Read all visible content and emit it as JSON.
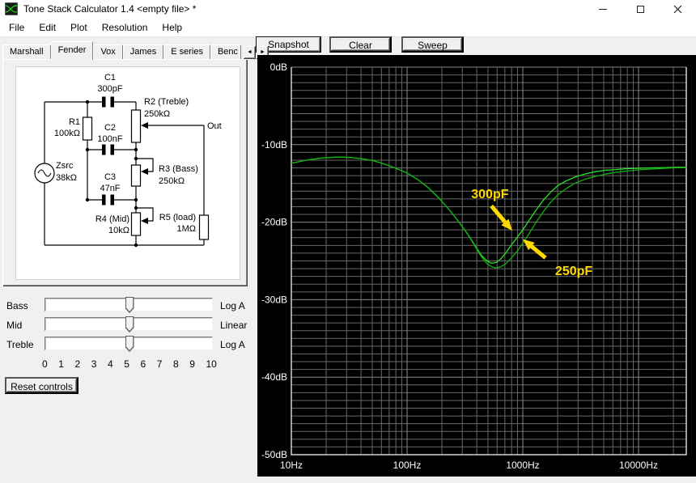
{
  "window": {
    "title": "Tone Stack Calculator 1.4 <empty file> *"
  },
  "menu": {
    "items": [
      "File",
      "Edit",
      "Plot",
      "Resolution",
      "Help"
    ]
  },
  "toolbar": {
    "snapshot": "Snapshot",
    "clear": "Clear",
    "sweep": "Sweep"
  },
  "tabs": {
    "items": [
      "Marshall",
      "Fender",
      "Vox",
      "James",
      "E series",
      "Benc"
    ],
    "active": "Fender"
  },
  "schematic": {
    "labels": {
      "c1_name": "C1",
      "c1_value": "300pF",
      "r2_name": "R2 (Treble)",
      "r2_value": "250kΩ",
      "r1_name": "R1",
      "r1_value": "100kΩ",
      "c2_name": "C2",
      "c2_value": "100nF",
      "zsrc_name": "Zsrc",
      "zsrc_value": "38kΩ",
      "c3_name": "C3",
      "c3_value": "47nF",
      "r3_name": "R3 (Bass)",
      "r3_value": "250kΩ",
      "r4_name": "R4 (Mid)",
      "r4_value": "10kΩ",
      "r5_name": "R5 (load)",
      "r5_value": "1MΩ",
      "out": "Out"
    }
  },
  "controls": {
    "sliders": [
      {
        "label": "Bass",
        "taper": "Log A",
        "value": 5
      },
      {
        "label": "Mid",
        "taper": "Linear",
        "value": 5
      },
      {
        "label": "Treble",
        "taper": "Log A",
        "value": 5
      }
    ],
    "scale": [
      "0",
      "1",
      "2",
      "3",
      "4",
      "5",
      "6",
      "7",
      "8",
      "9",
      "10"
    ],
    "reset_label": "Reset controls"
  },
  "chart_data": {
    "type": "line",
    "x_axis": {
      "scale": "log",
      "unit": "Hz",
      "min": 10,
      "max": 26000,
      "ticks": [
        10,
        100,
        1000,
        10000
      ],
      "tick_labels": [
        "10Hz",
        "100Hz",
        "1000Hz",
        "10000Hz"
      ]
    },
    "y_axis": {
      "unit": "dB",
      "min": -50,
      "max": 0,
      "major_step": 10,
      "minor_step": 1,
      "tick_labels": [
        "0dB",
        "-10dB",
        "-20dB",
        "-30dB",
        "-40dB",
        "-50dB"
      ]
    },
    "grid": true,
    "colors": {
      "background": "#000000",
      "grid_minor": "#686868",
      "grid_major": "#8a8a8a",
      "axis_border": "#d4d4d4",
      "label": "#ffffff",
      "annotation": "#ffd800"
    },
    "series": [
      {
        "name": "300pF",
        "color": "#2ae42a",
        "points": [
          [
            10,
            -12.4
          ],
          [
            14,
            -11.95
          ],
          [
            19,
            -11.7
          ],
          [
            25,
            -11.6
          ],
          [
            32,
            -11.65
          ],
          [
            40,
            -11.8
          ],
          [
            52,
            -12.1
          ],
          [
            65,
            -12.55
          ],
          [
            80,
            -13.05
          ],
          [
            100,
            -13.65
          ],
          [
            125,
            -14.55
          ],
          [
            155,
            -15.65
          ],
          [
            190,
            -16.95
          ],
          [
            230,
            -18.35
          ],
          [
            280,
            -19.95
          ],
          [
            340,
            -21.7
          ],
          [
            390,
            -23.1
          ],
          [
            440,
            -24.3
          ],
          [
            490,
            -25.0
          ],
          [
            540,
            -25.3
          ],
          [
            590,
            -25.2
          ],
          [
            650,
            -24.7
          ],
          [
            720,
            -23.9
          ],
          [
            800,
            -22.9
          ],
          [
            900,
            -21.9
          ],
          [
            1000,
            -21.0
          ],
          [
            1120,
            -19.9
          ],
          [
            1280,
            -18.6
          ],
          [
            1480,
            -17.3
          ],
          [
            1720,
            -16.2
          ],
          [
            2000,
            -15.3
          ],
          [
            2350,
            -14.7
          ],
          [
            2800,
            -14.2
          ],
          [
            3400,
            -13.8
          ],
          [
            4200,
            -13.5
          ],
          [
            5200,
            -13.3
          ],
          [
            6500,
            -13.2
          ],
          [
            8000,
            -13.1
          ],
          [
            10000,
            -13.05
          ],
          [
            13000,
            -13.0
          ],
          [
            17000,
            -12.95
          ],
          [
            21000,
            -12.92
          ],
          [
            26000,
            -12.9
          ]
        ]
      },
      {
        "name": "250pF",
        "color": "#12ae12",
        "points": [
          [
            10,
            -12.4
          ],
          [
            14,
            -11.95
          ],
          [
            19,
            -11.7
          ],
          [
            25,
            -11.6
          ],
          [
            32,
            -11.65
          ],
          [
            40,
            -11.8
          ],
          [
            52,
            -12.1
          ],
          [
            65,
            -12.55
          ],
          [
            80,
            -13.05
          ],
          [
            100,
            -13.65
          ],
          [
            125,
            -14.55
          ],
          [
            155,
            -15.65
          ],
          [
            190,
            -16.95
          ],
          [
            230,
            -18.35
          ],
          [
            280,
            -19.95
          ],
          [
            340,
            -21.75
          ],
          [
            390,
            -23.2
          ],
          [
            440,
            -24.5
          ],
          [
            490,
            -25.35
          ],
          [
            540,
            -25.75
          ],
          [
            590,
            -25.9
          ],
          [
            650,
            -25.75
          ],
          [
            720,
            -25.3
          ],
          [
            800,
            -24.6
          ],
          [
            900,
            -23.7
          ],
          [
            1000,
            -22.7
          ],
          [
            1120,
            -21.6
          ],
          [
            1280,
            -20.2
          ],
          [
            1480,
            -18.8
          ],
          [
            1720,
            -17.5
          ],
          [
            2000,
            -16.5
          ],
          [
            2350,
            -15.7
          ],
          [
            2800,
            -15.0
          ],
          [
            3400,
            -14.5
          ],
          [
            4200,
            -14.1
          ],
          [
            5200,
            -13.8
          ],
          [
            6500,
            -13.55
          ],
          [
            8000,
            -13.4
          ],
          [
            10000,
            -13.25
          ],
          [
            13000,
            -13.15
          ],
          [
            17000,
            -13.05
          ],
          [
            21000,
            -13.0
          ],
          [
            26000,
            -12.95
          ]
        ]
      }
    ],
    "annotations": [
      {
        "text": "300pF",
        "text_f": 520,
        "text_db": -16.4,
        "tail_f": 535,
        "tail_db": -17.9,
        "tip_f": 811,
        "tip_db": -21.1
      },
      {
        "text": "250pF",
        "text_f": 2760,
        "text_db": -26.3,
        "tail_f": 1570,
        "tail_db": -24.6,
        "tip_f": 1000,
        "tip_db": -22.2
      }
    ]
  }
}
